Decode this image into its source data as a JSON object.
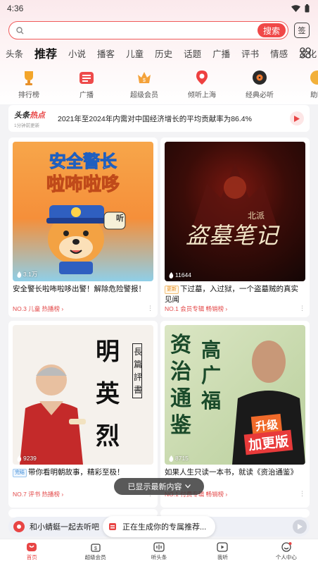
{
  "status": {
    "time": "4:36"
  },
  "search": {
    "placeholder": "",
    "button": "搜索",
    "sign_label": "签"
  },
  "tabs": [
    "头条",
    "推荐",
    "小说",
    "播客",
    "儿童",
    "历史",
    "话题",
    "广播",
    "评书",
    "情感",
    "文化"
  ],
  "quick_links": [
    "排行榜",
    "广播",
    "超级会员",
    "倾听上海",
    "经典必听",
    "助眠"
  ],
  "hot": {
    "logo_a": "头条",
    "logo_b": "热点",
    "updated": "1分钟前更新",
    "headline": "2021年至2024年内需对中国经济增长的平均贡献率为86.4%"
  },
  "cards": [
    {
      "cover_title_1": "安全警长",
      "cover_title_2": "啦咘啦哆",
      "cover_badge": "听",
      "plays": "3.1万",
      "title": "安全警长啦咘啦哆出警！解除危险警报！",
      "tag": "",
      "rank": "NO.3 儿童 热播榜 ›"
    },
    {
      "cover_title_1": "盗墓笔记",
      "cover_badge": "北派",
      "plays": "11644",
      "title": "下过墓，入过狱，一个盗墓贼的真实见闻",
      "tag": "更新",
      "rank": "NO.1 会员专辑 畅销榜 ›"
    },
    {
      "cover_title_1": "明",
      "cover_title_2": "英",
      "cover_title_3": "烈",
      "cover_sub": "長篇評書",
      "plays": "9239",
      "title": "带你看明朝故事，精彩至极！",
      "tag": "完结",
      "rank": "NO.7 评书 热播榜 ›"
    },
    {
      "cover_title_1": "资治通鉴",
      "cover_title_2": "高广福",
      "cover_badge_1": "升级",
      "cover_badge_2": "加更版",
      "plays": "8715",
      "title": "如果人生只读一本书，就读《资治通鉴》",
      "tag": "",
      "rank": "NO.1 付费专辑 畅销榜 ›"
    }
  ],
  "toast": "已显示最新内容",
  "mini_player": {
    "text": "和小蜻蜓一起去听吧"
  },
  "generating": "正在生成你的专属推荐...",
  "bottom_nav": [
    "首页",
    "超级会员",
    "听头条",
    "我听",
    "个人中心"
  ],
  "colors": {
    "accent": "#e84545",
    "tag": "#e89020"
  }
}
